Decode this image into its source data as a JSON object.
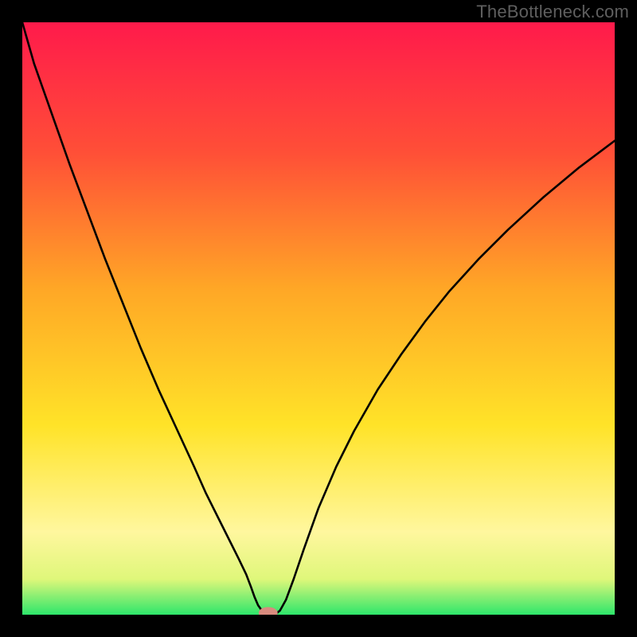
{
  "watermark": "TheBottleneck.com",
  "chart_data": {
    "type": "line",
    "title": "",
    "xlabel": "",
    "ylabel": "",
    "xlim": [
      0,
      100
    ],
    "ylim": [
      0,
      100
    ],
    "gradient_stops": [
      {
        "offset": 0,
        "color": "#ff1a4b"
      },
      {
        "offset": 22,
        "color": "#ff4f37"
      },
      {
        "offset": 45,
        "color": "#ffa726"
      },
      {
        "offset": 68,
        "color": "#ffe328"
      },
      {
        "offset": 86,
        "color": "#fff79e"
      },
      {
        "offset": 94,
        "color": "#dff77a"
      },
      {
        "offset": 100,
        "color": "#2ee66b"
      }
    ],
    "curve_x": [
      0,
      2,
      5,
      8,
      11,
      14,
      17,
      20,
      23,
      26,
      29,
      31,
      33,
      35,
      36.5,
      37.8,
      38.6,
      39.2,
      39.8,
      40.5,
      41.2,
      42,
      42.8,
      43.5,
      44.5,
      45.8,
      47.5,
      50,
      53,
      56,
      60,
      64,
      68,
      72,
      77,
      82,
      88,
      94,
      100
    ],
    "curve_y": [
      100,
      93,
      84.5,
      76,
      68,
      60,
      52.5,
      45,
      38,
      31.5,
      25,
      20.5,
      16.5,
      12.5,
      9.5,
      6.8,
      4.7,
      3,
      1.6,
      0.6,
      0.15,
      0.05,
      0.15,
      0.7,
      2.5,
      6,
      11,
      18,
      25,
      31,
      38,
      44,
      49.5,
      54.5,
      60,
      65,
      70.5,
      75.5,
      80
    ],
    "marker": {
      "x": 41.5,
      "y": 0.3,
      "rx": 1.6,
      "ry": 1.0,
      "color": "#d98b7e"
    }
  }
}
